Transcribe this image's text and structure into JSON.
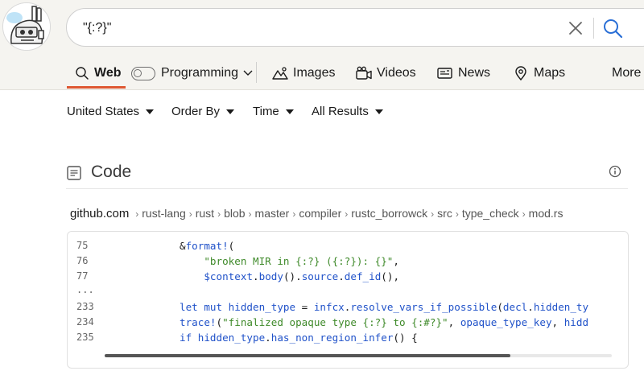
{
  "search": {
    "query": "\"{:?}\"",
    "clear_icon": "close-icon",
    "search_icon": "search-icon"
  },
  "tabs": {
    "web": "Web",
    "programming": "Programming",
    "images": "Images",
    "videos": "Videos",
    "news": "News",
    "maps": "Maps",
    "more": "More"
  },
  "filters": {
    "region": "United States",
    "order": "Order By",
    "time": "Time",
    "results": "All Results"
  },
  "section": {
    "title": "Code",
    "icon": "code-document-icon",
    "info_icon": "info-icon"
  },
  "result": {
    "domain": "github.com",
    "path": [
      "rust-lang",
      "rust",
      "blob",
      "master",
      "compiler",
      "rustc_borrowck",
      "src",
      "type_check",
      "mod.rs"
    ],
    "separator": "›",
    "lines": [
      {
        "num": "75",
        "tokens": [
          {
            "t": "            &",
            "c": ""
          },
          {
            "t": "format!",
            "c": "fn"
          },
          {
            "t": "(",
            "c": ""
          }
        ]
      },
      {
        "num": "76",
        "tokens": [
          {
            "t": "                ",
            "c": ""
          },
          {
            "t": "\"broken MIR in {:?} ({:?}): {}\"",
            "c": "str"
          },
          {
            "t": ",",
            "c": ""
          }
        ]
      },
      {
        "num": "77",
        "tokens": [
          {
            "t": "                ",
            "c": ""
          },
          {
            "t": "$context",
            "c": "var"
          },
          {
            "t": ".",
            "c": ""
          },
          {
            "t": "body",
            "c": "id"
          },
          {
            "t": "().",
            "c": ""
          },
          {
            "t": "source",
            "c": "id"
          },
          {
            "t": ".",
            "c": ""
          },
          {
            "t": "def_id",
            "c": "id"
          },
          {
            "t": "(),",
            "c": ""
          }
        ]
      },
      {
        "num": "...",
        "tokens": []
      },
      {
        "num": "233",
        "tokens": [
          {
            "t": "            ",
            "c": ""
          },
          {
            "t": "let mut",
            "c": "kw"
          },
          {
            "t": " ",
            "c": ""
          },
          {
            "t": "hidden_type",
            "c": "id"
          },
          {
            "t": " = ",
            "c": ""
          },
          {
            "t": "infcx",
            "c": "id"
          },
          {
            "t": ".",
            "c": ""
          },
          {
            "t": "resolve_vars_if_possible",
            "c": "id"
          },
          {
            "t": "(",
            "c": ""
          },
          {
            "t": "decl",
            "c": "id"
          },
          {
            "t": ".",
            "c": ""
          },
          {
            "t": "hidden_ty",
            "c": "id"
          }
        ]
      },
      {
        "num": "234",
        "tokens": [
          {
            "t": "            ",
            "c": ""
          },
          {
            "t": "trace!",
            "c": "fn"
          },
          {
            "t": "(",
            "c": ""
          },
          {
            "t": "\"finalized opaque type {:?} to {:#?}\"",
            "c": "str"
          },
          {
            "t": ", ",
            "c": ""
          },
          {
            "t": "opaque_type_key",
            "c": "id"
          },
          {
            "t": ", ",
            "c": ""
          },
          {
            "t": "hidd",
            "c": "id"
          }
        ]
      },
      {
        "num": "235",
        "tokens": [
          {
            "t": "            ",
            "c": ""
          },
          {
            "t": "if",
            "c": "kw"
          },
          {
            "t": " ",
            "c": ""
          },
          {
            "t": "hidden_type",
            "c": "id"
          },
          {
            "t": ".",
            "c": ""
          },
          {
            "t": "has_non_region_infer",
            "c": "id"
          },
          {
            "t": "() {",
            "c": ""
          }
        ]
      }
    ],
    "scroll_fraction": 0.8
  }
}
